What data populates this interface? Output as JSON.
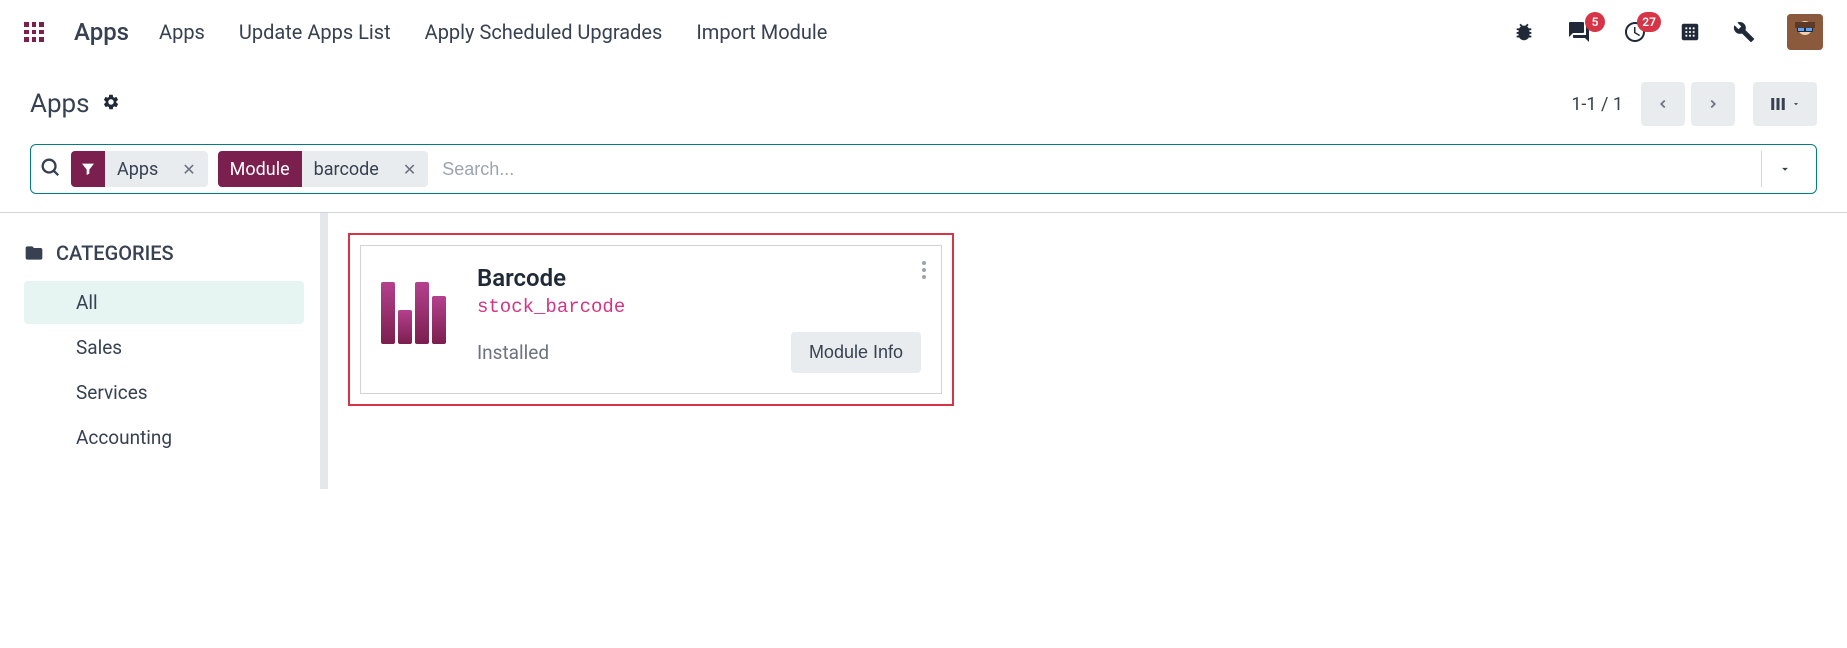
{
  "topnav": {
    "app_title": "Apps",
    "links": [
      "Apps",
      "Update Apps List",
      "Apply Scheduled Upgrades",
      "Import Module"
    ],
    "messages_count": "5",
    "activities_count": "27"
  },
  "header": {
    "page_title": "Apps",
    "pager": "1-1 / 1"
  },
  "search": {
    "placeholder": "Search...",
    "facets": [
      {
        "type": "filter",
        "value": "Apps"
      },
      {
        "type": "label",
        "label": "Module",
        "value": "barcode"
      }
    ]
  },
  "sidebar": {
    "section_title": "CATEGORIES",
    "items": [
      "All",
      "Sales",
      "Services",
      "Accounting"
    ],
    "active_index": 0
  },
  "modules": [
    {
      "title": "Barcode",
      "technical_name": "stock_barcode",
      "status": "Installed",
      "action_label": "Module Info"
    }
  ]
}
